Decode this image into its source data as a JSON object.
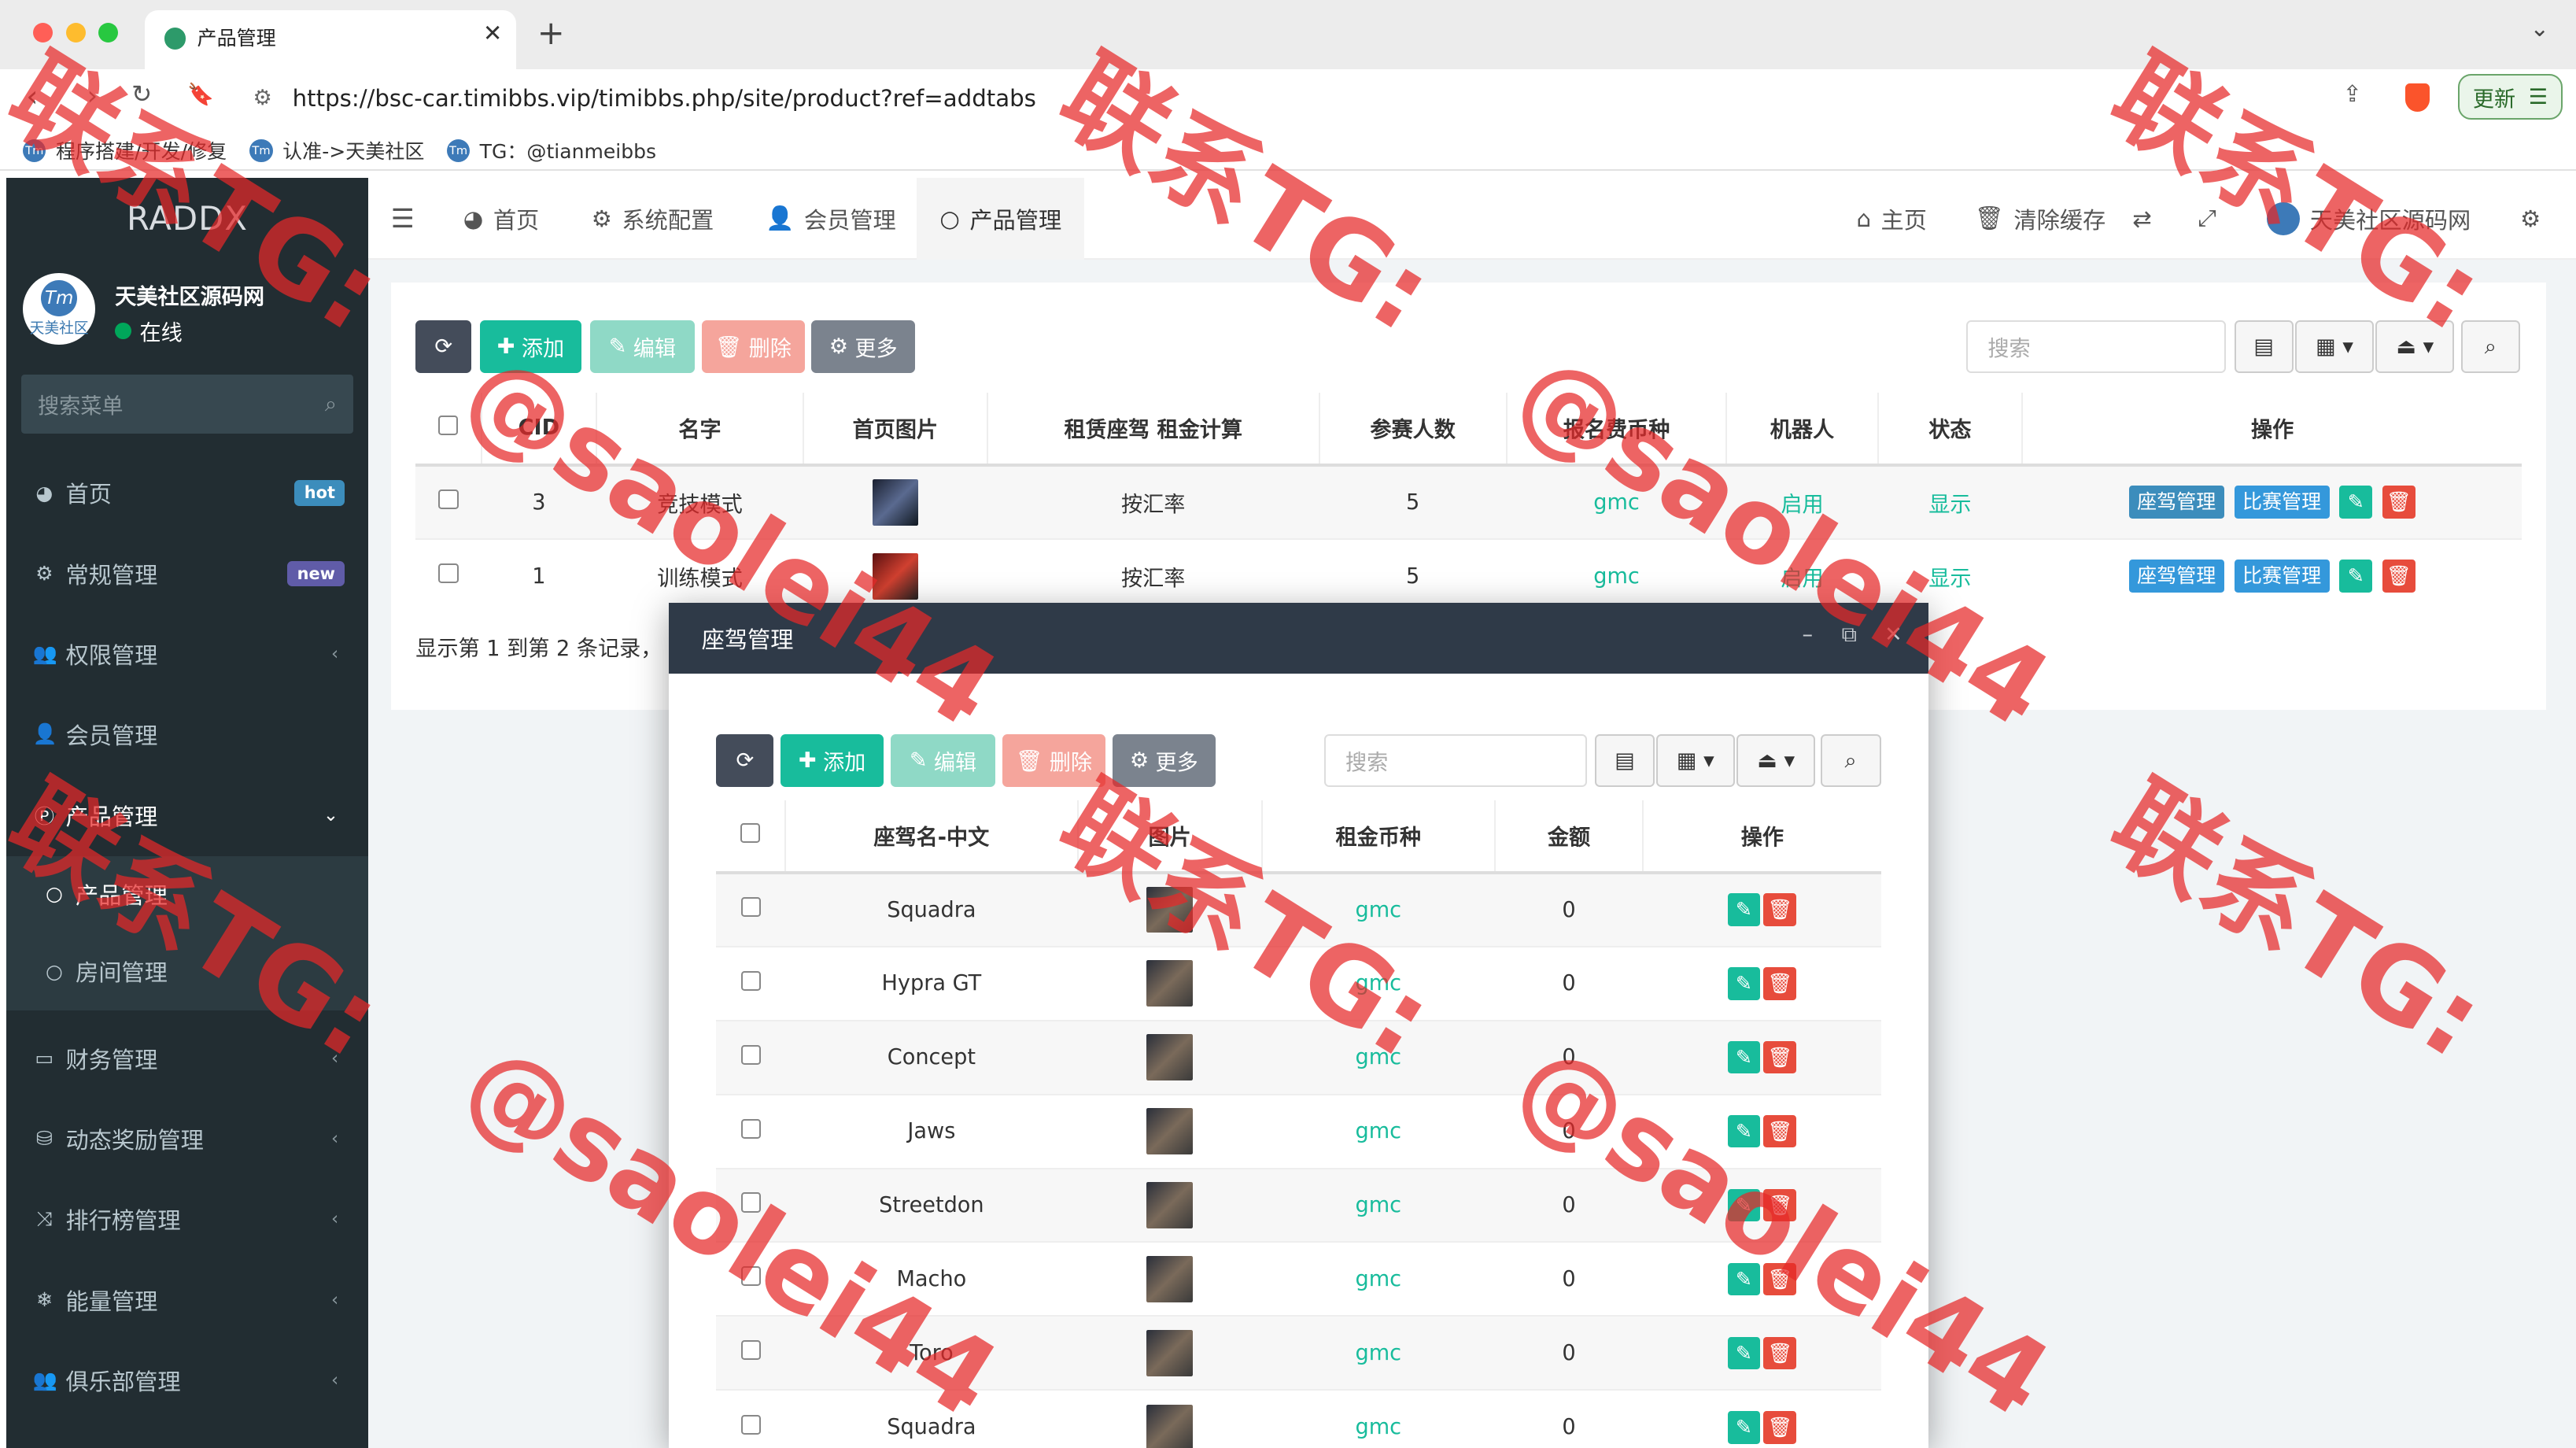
{
  "browser": {
    "tab_title": "产品管理",
    "url": "https://bsc-car.timibbs.vip/timibbs.php/site/product?ref=addtabs",
    "update_label": "更新",
    "bookmarks": [
      "程序搭建/开发/修复",
      "认准->天美社区",
      "TG：@tianmeibbs"
    ]
  },
  "sidebar": {
    "logo": "RADDX",
    "user_name": "天美社区源码网",
    "user_status": "在线",
    "avatar_text": "天美社区",
    "search_placeholder": "搜索菜单",
    "items": [
      {
        "label": "首页",
        "badge": "hot"
      },
      {
        "label": "常规管理",
        "badge": "new"
      },
      {
        "label": "权限管理"
      },
      {
        "label": "会员管理"
      },
      {
        "label": "产品管理"
      },
      {
        "label": "产品管理"
      },
      {
        "label": "房间管理"
      },
      {
        "label": "财务管理"
      },
      {
        "label": "动态奖励管理"
      },
      {
        "label": "排行榜管理"
      },
      {
        "label": "能量管理"
      },
      {
        "label": "俱乐部管理"
      }
    ]
  },
  "header": {
    "nav": [
      "首页",
      "系统配置",
      "会员管理",
      "产品管理"
    ],
    "right": [
      "主页",
      "清除缓存",
      "天美社区源码网"
    ]
  },
  "toolbar": {
    "refresh_label": "",
    "add_label": "添加",
    "edit_label": "编辑",
    "delete_label": "删除",
    "more_label": "更多",
    "search_placeholder": "搜索"
  },
  "product_table": {
    "columns": [
      "CID",
      "名字",
      "首页图片",
      "租赁座驾 租金计算",
      "参赛人数",
      "报名费币种",
      "机器人",
      "状态",
      "操作"
    ],
    "rows": [
      {
        "cid": "3",
        "name": "竞技模式",
        "calc": "按汇率",
        "players": "5",
        "coin": "gmc",
        "robot": "启用",
        "status": "显示"
      },
      {
        "cid": "1",
        "name": "训练模式",
        "calc": "按汇率",
        "players": "5",
        "coin": "gmc",
        "robot": "启用",
        "status": "显示"
      }
    ],
    "op_labels": [
      "座驾管理",
      "比赛管理"
    ],
    "footer": "显示第 1 到第 2 条记录，"
  },
  "modal": {
    "title": "座驾管理",
    "add_label": "添加",
    "edit_label": "编辑",
    "delete_label": "删除",
    "more_label": "更多",
    "search_placeholder": "搜索",
    "columns": [
      "座驾名-中文",
      "图片",
      "租金币种",
      "金额",
      "操作"
    ],
    "rows": [
      {
        "name": "Squadra",
        "coin": "gmc",
        "amount": "0"
      },
      {
        "name": "Hypra GT",
        "coin": "gmc",
        "amount": "0"
      },
      {
        "name": "Concept",
        "coin": "gmc",
        "amount": "0"
      },
      {
        "name": "Jaws",
        "coin": "gmc",
        "amount": "0"
      },
      {
        "name": "Streetdon",
        "coin": "gmc",
        "amount": "0"
      },
      {
        "name": "Macho",
        "coin": "gmc",
        "amount": "0"
      },
      {
        "name": "Toro",
        "coin": "gmc",
        "amount": "0"
      },
      {
        "name": "Squadra",
        "coin": "gmc",
        "amount": "0"
      }
    ]
  },
  "watermark": {
    "tg": "联系TG:",
    "handle": "@saolei44"
  },
  "colors": {
    "sidebar_bg": "#222d32",
    "active_menu": "#5b74e8",
    "accent_green": "#18bc9c",
    "danger": "#e74c3c",
    "modal_head": "#2f3a48"
  }
}
